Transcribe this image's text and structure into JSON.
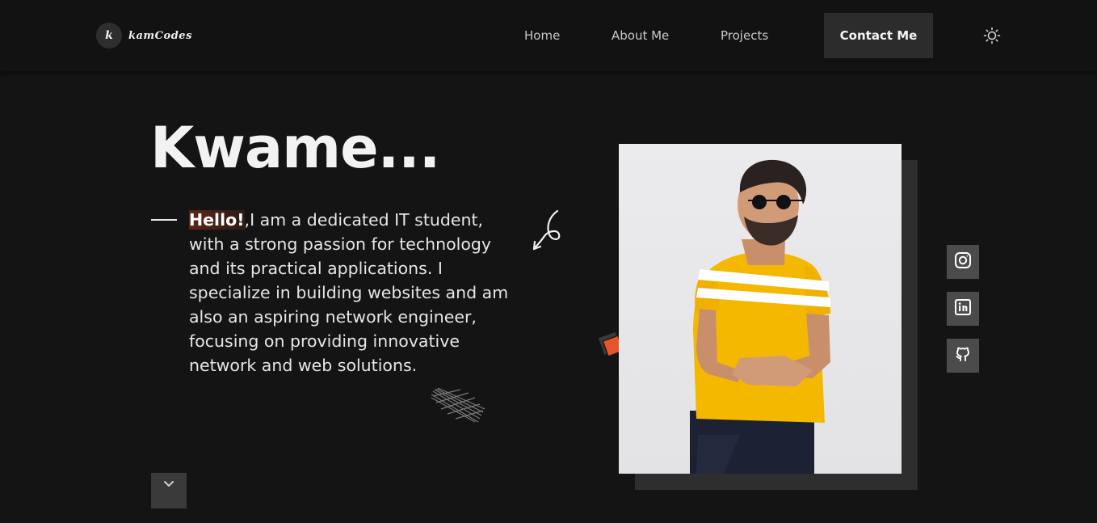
{
  "header": {
    "logo_initial": "k",
    "logo_text": "kamCodes",
    "nav": {
      "home": "Home",
      "about": "About Me",
      "projects": "Projects",
      "contact": "Contact Me"
    },
    "theme_icon": "sun-icon"
  },
  "hero": {
    "title": "Kwame...",
    "greeting": "Hello!",
    "intro": ",I am a dedicated IT student, with a strong passion for technology and its practical applications. I specialize in building websites and am also an aspiring network engineer, focusing on providing innovative network and web solutions.",
    "scroll_icon": "chevron-down-icon"
  },
  "social": [
    {
      "icon": "instagram-icon"
    },
    {
      "icon": "linkedin-icon"
    },
    {
      "icon": "github-icon"
    }
  ],
  "colors": {
    "background": "#141414",
    "header_bg": "#121212",
    "accent_orange": "#e8542a",
    "button_bg": "#2c2c2c",
    "social_bg": "#4b4b4b",
    "shirt_yellow": "#f5b800"
  }
}
